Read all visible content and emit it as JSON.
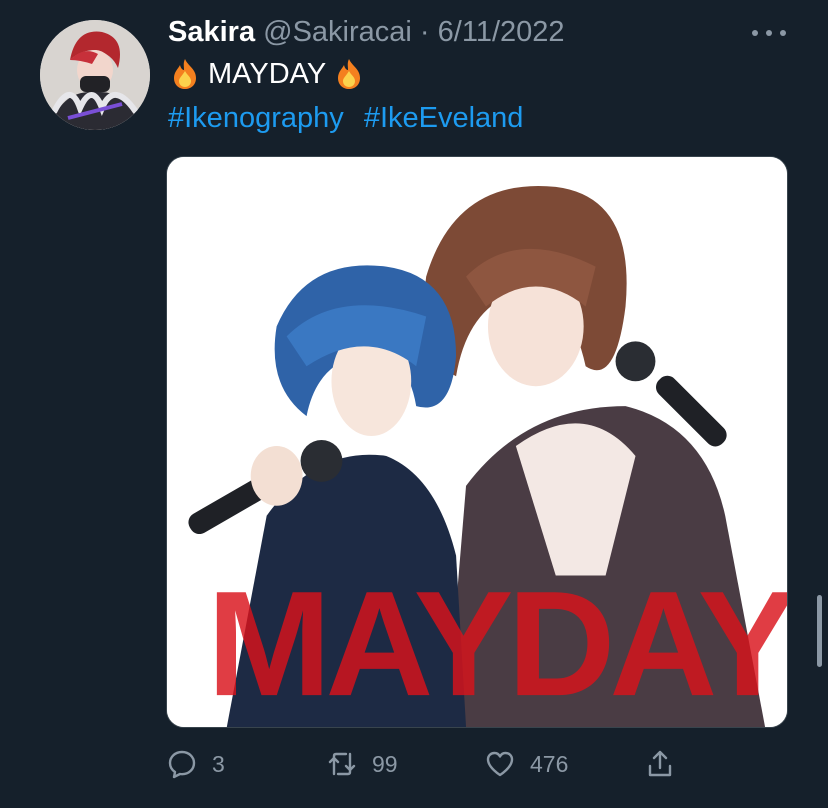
{
  "tweet": {
    "display_name": "Sakira",
    "handle": "@Sakiracai",
    "separator": "·",
    "date": "6/11/2022",
    "text": "MAYDAY",
    "emoji": "fire-icon",
    "hashtags": [
      "#Ikenography",
      "#IkeEveland"
    ],
    "media_overlay_text": "MAYDAY"
  },
  "actions": {
    "replies": "3",
    "retweets": "99",
    "likes": "476"
  },
  "icons": {
    "more": "more-horizontal-icon",
    "reply": "reply-icon",
    "retweet": "retweet-icon",
    "like": "heart-icon",
    "share": "share-icon"
  },
  "colors": {
    "background": "#15202b",
    "text": "#ffffff",
    "secondary_text": "#8b98a5",
    "link": "#1d9bf0"
  }
}
